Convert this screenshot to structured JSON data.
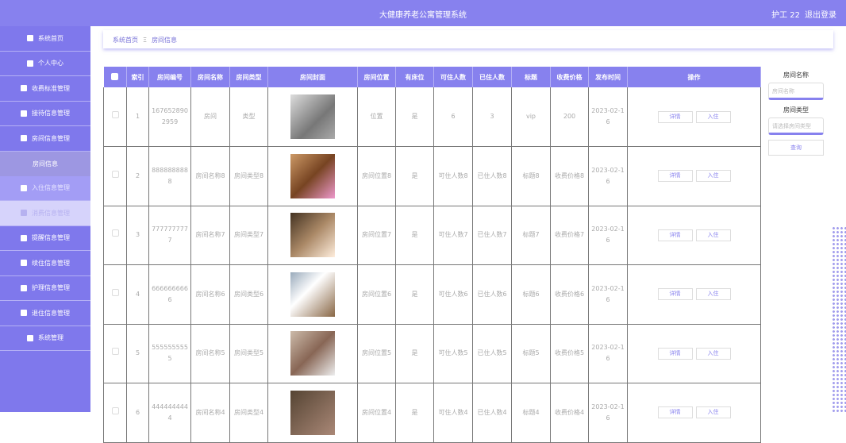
{
  "header": {
    "title": "大健康养老公寓管理系统",
    "user": "护工 22",
    "logout": "退出登录"
  },
  "sidebar": {
    "items": [
      {
        "label": "系统首页",
        "icon": "home-icon"
      },
      {
        "label": "个人中心",
        "icon": "user-icon"
      },
      {
        "label": "收费标准管理",
        "icon": "list-icon"
      },
      {
        "label": "接待信息管理",
        "icon": "grid-icon"
      },
      {
        "label": "房间信息管理",
        "icon": "monitor-icon"
      },
      {
        "label": "房间信息",
        "sub": true
      },
      {
        "label": "入住信息管理",
        "icon": "grid-icon",
        "state": "hover"
      },
      {
        "label": "消费信息管理",
        "icon": "grid-icon",
        "state": "light"
      },
      {
        "label": "提醒信息管理",
        "icon": "bell-icon"
      },
      {
        "label": "续住信息管理",
        "icon": "grid-icon"
      },
      {
        "label": "护理信息管理",
        "icon": "grid-icon"
      },
      {
        "label": "退住信息管理",
        "icon": "message-icon"
      },
      {
        "label": "系统管理",
        "icon": "clipboard-icon"
      }
    ]
  },
  "breadcrumb": {
    "home": "系统首页",
    "sep": "Ξ",
    "current": "房间信息"
  },
  "table": {
    "headers": [
      "",
      "索引",
      "房间编号",
      "房间名称",
      "房间类型",
      "房间封面",
      "房间位置",
      "有床位",
      "可住人数",
      "已住人数",
      "标题",
      "收费价格",
      "发布时间",
      "操作"
    ],
    "detail_label": "详情",
    "checkin_label": "入住",
    "rows": [
      [
        "1",
        "1676528902959",
        "房间",
        "类型",
        "位置",
        "是",
        "6",
        "3",
        "vip",
        "200",
        "2023-02-16"
      ],
      [
        "2",
        "8888888888",
        "房间名称8",
        "房间类型8",
        "房间位置8",
        "是",
        "可住人数8",
        "已住人数8",
        "标题8",
        "收费价格8",
        "2023-02-16"
      ],
      [
        "3",
        "7777777777",
        "房间名称7",
        "房间类型7",
        "房间位置7",
        "是",
        "可住人数7",
        "已住人数7",
        "标题7",
        "收费价格7",
        "2023-02-16"
      ],
      [
        "4",
        "6666666666",
        "房间名称6",
        "房间类型6",
        "房间位置6",
        "是",
        "可住人数6",
        "已住人数6",
        "标题6",
        "收费价格6",
        "2023-02-16"
      ],
      [
        "5",
        "5555555555",
        "房间名称5",
        "房间类型5",
        "房间位置5",
        "是",
        "可住人数5",
        "已住人数5",
        "标题5",
        "收费价格5",
        "2023-02-16"
      ],
      [
        "6",
        "4444444444",
        "房间名称4",
        "房间类型4",
        "房间位置4",
        "是",
        "可住人数4",
        "已住人数4",
        "标题4",
        "收费价格4",
        "2023-02-16"
      ]
    ]
  },
  "search": {
    "name_label": "房间名称",
    "name_placeholder": "房间名称",
    "type_label": "房间类型",
    "type_placeholder": "请选择房间类型",
    "query": "查询"
  },
  "colors": {
    "accent": "#8781ee"
  }
}
